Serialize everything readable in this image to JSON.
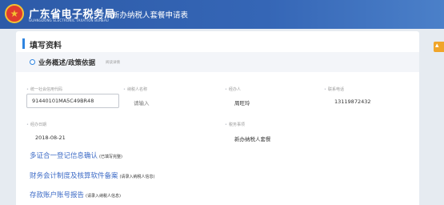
{
  "header": {
    "brand_cn": "广东省电子税务局",
    "brand_en": "GUANGDONG ELECTRONIC TAXATION BUREAU",
    "page_title": "新办纳税人套餐申请表"
  },
  "card": {
    "title": "填写资料",
    "subsection": {
      "title": "业务概述/政策依据",
      "hint": "阅读详情"
    },
    "fields": {
      "credit_code": {
        "label": "统一社会信用代码",
        "value": "91440101MA5C49BR48"
      },
      "taxpayer_name": {
        "label": "纳税人名称",
        "placeholder": "请输入"
      },
      "operator": {
        "label": "经办人",
        "value": "周旺玲"
      },
      "phone": {
        "label": "联系电话",
        "value": "13119872432"
      },
      "handle_date": {
        "label": "经办日期",
        "value": "2018-08-21"
      },
      "tax_item": {
        "label": "税务事项",
        "value": "新办纳税人套餐"
      }
    },
    "links": [
      {
        "label": "多证合一登记信息确认",
        "note": "(已填写完整)"
      },
      {
        "label": "财务会计制度及核算软件备案",
        "note": "(请录入纳税人信息)"
      },
      {
        "label": "存款账户账号报告",
        "note": "(请录入纳税人信息)"
      }
    ]
  },
  "colors": {
    "header_bg": "#2f5faf",
    "accent": "#2f84e0",
    "link": "#3d6bc6",
    "side_tab": "#f0a52a"
  }
}
